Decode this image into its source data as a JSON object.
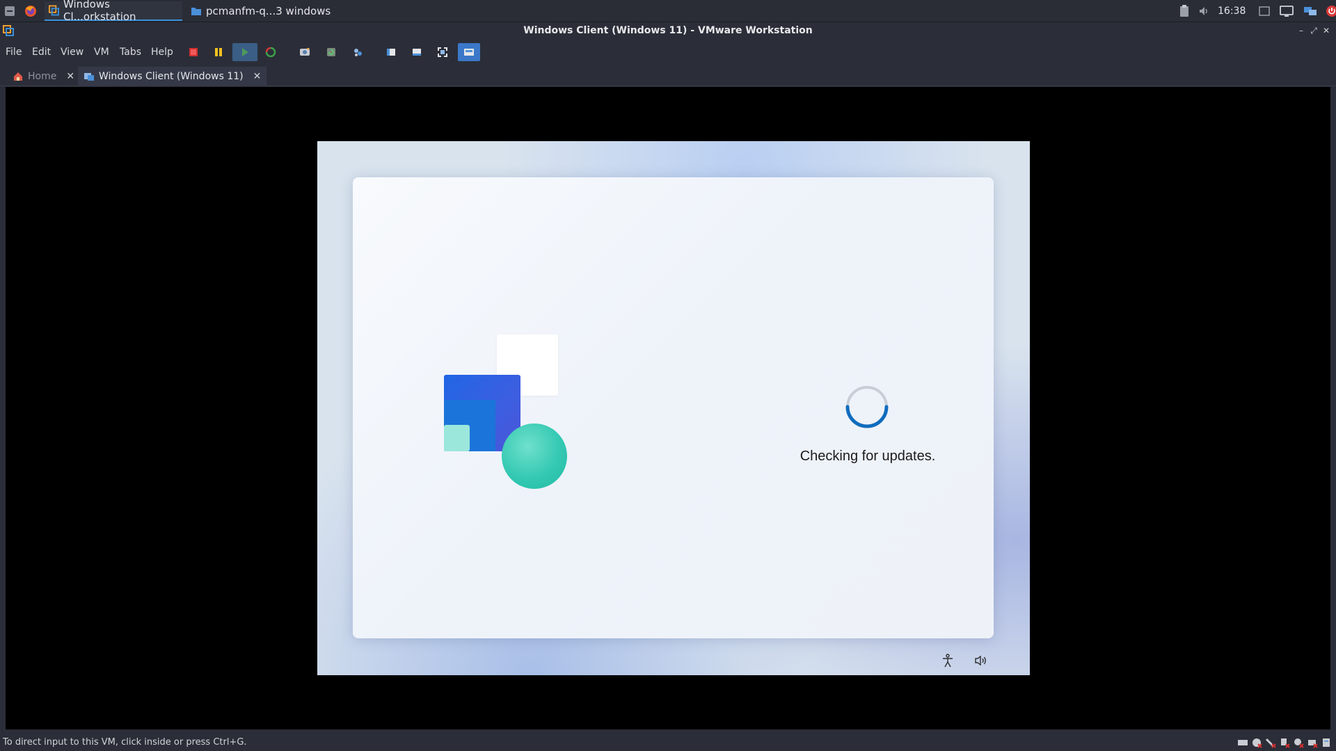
{
  "taskbar": {
    "tasks": [
      {
        "label": "Windows Cl...orkstation"
      },
      {
        "label": "pcmanfm-q...3 windows"
      }
    ],
    "clock": "16:38"
  },
  "window": {
    "title": "Windows Client (Windows 11) - VMware Workstation"
  },
  "menu": {
    "items": [
      "File",
      "Edit",
      "View",
      "VM",
      "Tabs",
      "Help"
    ]
  },
  "toolbar": {
    "icons": [
      "power-off-icon",
      "pause-icon",
      "play-icon",
      "reset-icon",
      "snapshot-icon",
      "revert-snapshot-icon",
      "manage-snapshots-icon",
      "library-icon",
      "thumbnail-bar-icon",
      "full-screen-icon",
      "unity-icon"
    ]
  },
  "tabs": [
    {
      "label": "Home"
    },
    {
      "label": "Windows Client (Windows 11)"
    }
  ],
  "guest": {
    "status": "Checking for updates."
  },
  "statusbar": {
    "hint": "To direct input to this VM, click inside or press Ctrl+G."
  },
  "colors": {
    "accent": "#3b8fd8",
    "spinner": "#0f6cbd",
    "vm_background": "#000000"
  }
}
